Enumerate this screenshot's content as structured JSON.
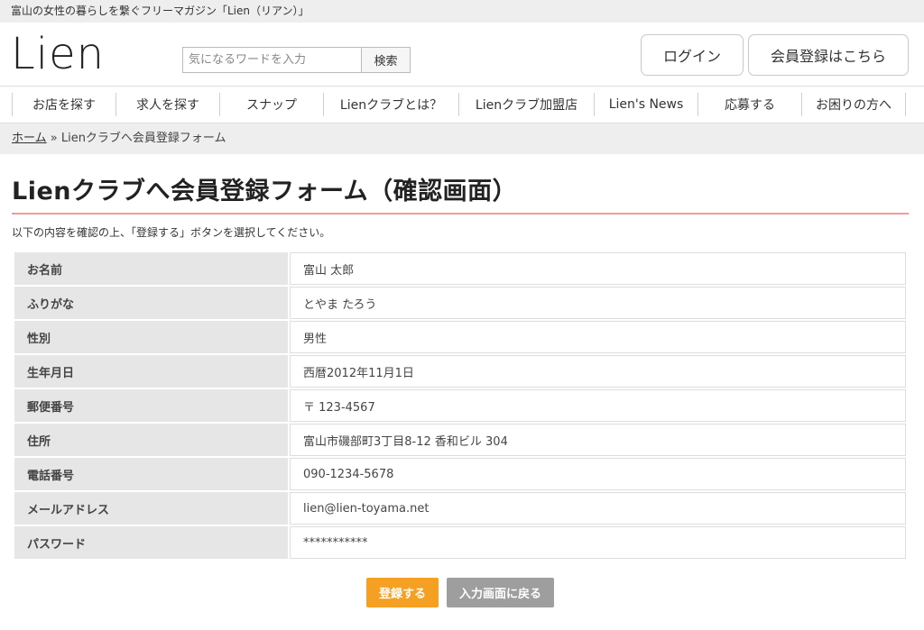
{
  "topbar": {
    "tagline": "富山の女性の暮らしを繋ぐフリーマガジン「Lien（リアン）」"
  },
  "header": {
    "logo_text": "Lien",
    "search_placeholder": "気になるワードを入力",
    "search_button": "検索",
    "login_button": "ログイン",
    "register_button": "会員登録はこちら"
  },
  "nav": {
    "items": [
      {
        "label": "お店を探す"
      },
      {
        "label": "求人を探す"
      },
      {
        "label": "スナップ"
      },
      {
        "label": "Lienクラブとは？"
      },
      {
        "label": "Lienクラブ加盟店"
      },
      {
        "label": "Lien's News"
      },
      {
        "label": "応募する"
      },
      {
        "label": "お困りの方へ"
      }
    ]
  },
  "breadcrumb": {
    "home": "ホーム",
    "separator": " » ",
    "current": "Lienクラブへ会員登録フォーム"
  },
  "main": {
    "title": "Lienクラブへ会員登録フォーム（確認画面）",
    "instructions": "以下の内容を確認の上、「登録する」ボタンを選択してください。",
    "rows": [
      {
        "label": "お名前",
        "value": "富山 太郎"
      },
      {
        "label": "ふりがな",
        "value": "とやま たろう"
      },
      {
        "label": "性別",
        "value": "男性"
      },
      {
        "label": "生年月日",
        "value": "西暦2012年11月1日"
      },
      {
        "label": "郵便番号",
        "value": "〒 123-4567"
      },
      {
        "label": "住所",
        "value": "富山市磯部町3丁目8-12 香和ビル 304"
      },
      {
        "label": "電話番号",
        "value": "090-1234-5678"
      },
      {
        "label": "メールアドレス",
        "value": "lien@lien-toyama.net"
      },
      {
        "label": "パスワード",
        "value": "***********"
      }
    ],
    "submit_button": "登録する",
    "back_button": "入力画面に戻る"
  },
  "colors": {
    "accent_orange": "#f5a023",
    "title_rule": "#f29b98",
    "button_gray": "#9e9e9e"
  }
}
